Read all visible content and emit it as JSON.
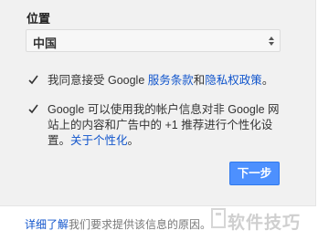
{
  "location": {
    "label": "位置",
    "selected": "中国"
  },
  "terms": {
    "prefix": "我同意接受 Google ",
    "tos_link": "服务条款",
    "middle": "和",
    "privacy_link": "隐私权政策",
    "suffix": "。",
    "checked": true
  },
  "personalize": {
    "text": "Google 可以使用我的帐户信息对非 Google 网站上的内容和广告中的 +1 推荐进行个性化设置。",
    "link": "关于个性化",
    "suffix": "。",
    "checked": true
  },
  "next_button": "下一步",
  "footer": {
    "link": "详细了解",
    "text": "我们要求提供该信息的原因。"
  },
  "watermark": "软件技巧",
  "colors": {
    "accent": "#4d90fe",
    "link": "#1155cc",
    "panel_bg": "#f1f1f1"
  },
  "icons": {
    "checkbox": "checkmark-icon",
    "select": "updown-arrows-icon",
    "watermark_logo": "watermark-logo-icon"
  }
}
